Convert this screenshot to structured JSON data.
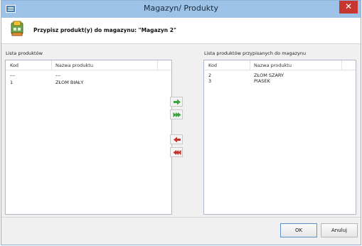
{
  "window": {
    "title": "Magazyn/ Produkty",
    "close_glyph": "✕",
    "icon": "window-app-icon"
  },
  "header": {
    "text": "Przypisz produkt(y) do magazynu: \"Magazyn 2\"",
    "icon": "warehouse-products-icon"
  },
  "left": {
    "label": "Lista produktów",
    "columns": [
      "Kod",
      "Nazwa produktu"
    ],
    "rows": [
      {
        "code": "---",
        "name": "---"
      },
      {
        "code": "1",
        "name": "ZŁOM BIAŁY"
      }
    ]
  },
  "right": {
    "label": "Lista produktów przypisanych do magazynu",
    "columns": [
      "Kod",
      "Nazwa produktu"
    ],
    "rows": [
      {
        "code": "2",
        "name": "ZŁOM SZARY"
      },
      {
        "code": "3",
        "name": "PIASEK"
      }
    ]
  },
  "arrows": [
    {
      "name": "move-right-icon",
      "color": "#3aa43a"
    },
    {
      "name": "move-all-right-icon",
      "color": "#3aa43a"
    },
    {
      "name": "move-left-icon",
      "color": "#c8302a"
    },
    {
      "name": "move-all-left-icon",
      "color": "#c8302a"
    }
  ],
  "footer": {
    "ok_label": "OK",
    "cancel_label": "Anuluj"
  }
}
